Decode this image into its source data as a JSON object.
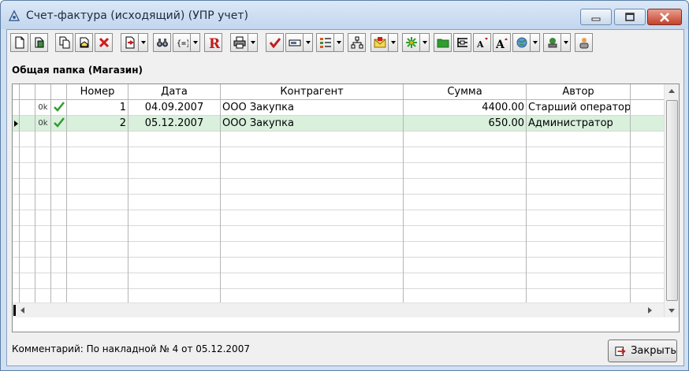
{
  "window": {
    "title": "Счет-фактура (исходящий) (УПР учет)"
  },
  "toolbar": {
    "buttons": [
      {
        "icon": "new-document-icon"
      },
      {
        "icon": "save-icon"
      },
      {
        "icon": "copy-icon"
      },
      {
        "icon": "open-envelope-icon"
      },
      {
        "icon": "delete-icon"
      },
      {
        "icon": "export-icon"
      },
      {
        "icon": "binoculars-search-icon"
      },
      {
        "icon": "filter-braces-icon"
      },
      {
        "icon": "report-r-icon"
      },
      {
        "icon": "print-icon"
      },
      {
        "icon": "checkmark-icon"
      },
      {
        "icon": "label-icon"
      },
      {
        "icon": "list-tree-icon"
      },
      {
        "icon": "hierarchy-icon"
      },
      {
        "icon": "mail-icon"
      },
      {
        "icon": "snowflake-icon"
      },
      {
        "icon": "green-folder-icon"
      },
      {
        "icon": "columns-icon"
      },
      {
        "icon": "font-decrease-icon"
      },
      {
        "icon": "font-increase-icon"
      },
      {
        "icon": "globe-icon"
      },
      {
        "icon": "stamp-icon"
      },
      {
        "icon": "user-icon"
      }
    ]
  },
  "folder_label": "Общая папка (Магазин)",
  "table": {
    "columns": [
      "",
      "",
      "",
      "",
      "Номер",
      "Дата",
      "Контрагент",
      "Сумма",
      "Автор",
      ""
    ],
    "rows": [
      {
        "status": "0k",
        "checked": true,
        "number": "1",
        "date": "04.09.2007",
        "counterparty": "ООО Закупка",
        "sum": "4400.00",
        "author": "Старший оператор",
        "selected": false
      },
      {
        "status": "0k",
        "checked": true,
        "number": "2",
        "date": "05.12.2007",
        "counterparty": "ООО Закупка",
        "sum": "650.00",
        "author": "Администратор",
        "selected": true
      }
    ]
  },
  "comment": "Комментарий: По накладной № 4 от 05.12.2007",
  "close_button": "Закрыть",
  "colors": {
    "selected_row": "#d9f0dc",
    "check_green": "#2e9e2e",
    "delete_red": "#d31a1a",
    "report_red": "#c21c1c"
  }
}
